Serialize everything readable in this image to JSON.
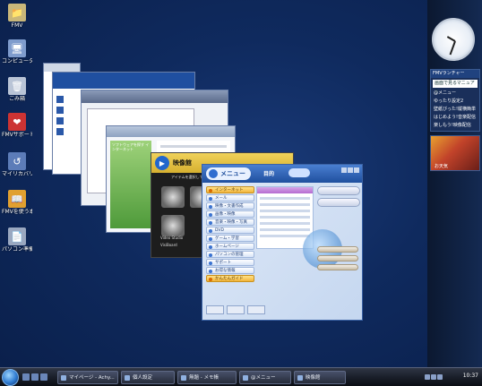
{
  "desktop": {
    "icons": [
      {
        "label": "FMV",
        "icon": "user-folder-icon",
        "color": "#c9b77a"
      },
      {
        "label": "コンピュータ",
        "icon": "computer-icon",
        "color": "#7f9ccd"
      },
      {
        "label": "ごみ箱",
        "icon": "recycle-bin-icon",
        "color": "#b9c4d6"
      },
      {
        "label": "FMVサポートナビ",
        "icon": "support-navi-icon",
        "color": "#cc3333"
      },
      {
        "label": "マイリカバリ",
        "icon": "my-recovery-icon",
        "color": "#5c7cb8"
      },
      {
        "label": "FMVを使う本マニュアル",
        "icon": "manual-icon",
        "color": "#e0a030"
      },
      {
        "label": "パソコン準備ばっちりガ...",
        "icon": "setup-guide-icon",
        "color": "#9aa8c0"
      }
    ]
  },
  "windows": {
    "menu_window": {
      "logo": "メニュー",
      "title": "目的",
      "menu_items": [
        "インターネット",
        "メール",
        "映像・文書作成",
        "画像・映像",
        "音楽・映像・写真",
        "DVD",
        "ゲーム・学習",
        "ホームページ",
        "パソコンの管理",
        "サポート",
        "お得な情報",
        "かんたんガイド"
      ],
      "selected_index": 0
    },
    "video_window": {
      "title": "映像館",
      "subtitle": "アイテムを選択してください",
      "labels": [
        "Video Studio",
        "VisiBoard"
      ]
    },
    "explorer_window": {
      "sidebar_text": "ソフトウェアを探す インターネット"
    }
  },
  "sidebar": {
    "clock": {
      "label": "clock"
    },
    "gadget": {
      "title": "FMVランチャー",
      "search_text": "画面で見るマニュアル",
      "items": [
        "@メニュー",
        "ゆったり設定2",
        "壁紙びった!縦横簡単",
        "はじめよう!音楽配信",
        "楽しもう!映像配信"
      ]
    },
    "photo_label": "お天気"
  },
  "taskbar": {
    "tasks": [
      "マイページ - Achy...",
      "個人設定",
      "無題 - メモ帳",
      "@メニュー",
      "映像館"
    ],
    "time": "10:37"
  }
}
